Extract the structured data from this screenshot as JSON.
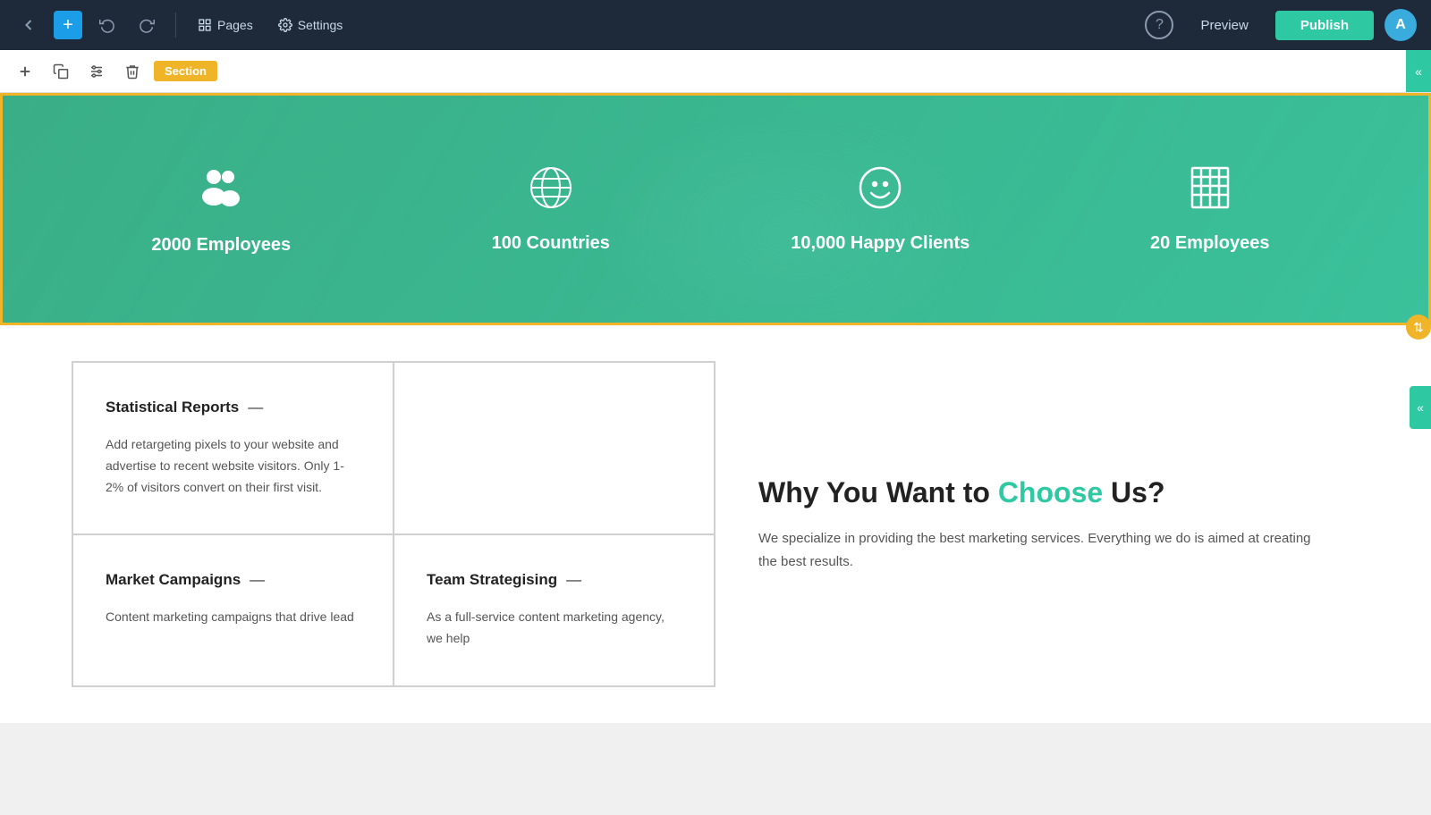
{
  "topnav": {
    "back_icon": "‹",
    "add_icon": "+",
    "undo_icon": "↩",
    "redo_icon": "↪",
    "pages_label": "Pages",
    "settings_label": "Settings",
    "help_icon": "?",
    "preview_label": "Preview",
    "publish_label": "Publish",
    "avatar_letter": "A"
  },
  "toolbar": {
    "add_icon": "+",
    "duplicate_icon": "⧉",
    "settings_icon": "⚙",
    "delete_icon": "🗑",
    "section_label": "Section",
    "collapse_icon": "«"
  },
  "stats": {
    "items": [
      {
        "icon": "👥",
        "label": "2000 Employees"
      },
      {
        "icon": "🌐",
        "label": "100 Countries"
      },
      {
        "icon": "☺",
        "label": "10,000 Happy Clients"
      },
      {
        "icon": "🏢",
        "label": "20 Employees"
      }
    ]
  },
  "cards": [
    {
      "title": "Statistical Reports",
      "dash": "—",
      "text": "Add retargeting pixels to your website and advertise to recent website visitors. Only 1-2% of visitors convert on their first visit."
    },
    {
      "title": "",
      "dash": "",
      "text": ""
    },
    {
      "title": "Market Campaigns",
      "dash": "—",
      "text": "Content marketing campaigns that drive lead"
    },
    {
      "title": "Team Strategising",
      "dash": "—",
      "text": "As a full-service content marketing agency, we help"
    }
  ],
  "right_side": {
    "title_part1": "Why You Want to ",
    "title_highlight": "Choose",
    "title_part2": " Us?",
    "body": "We specialize in providing the best marketing services. Everything we do is aimed at creating the best results."
  },
  "right_handle": {
    "icon": "«"
  },
  "bottom_handle": {
    "icon": "⇅"
  }
}
